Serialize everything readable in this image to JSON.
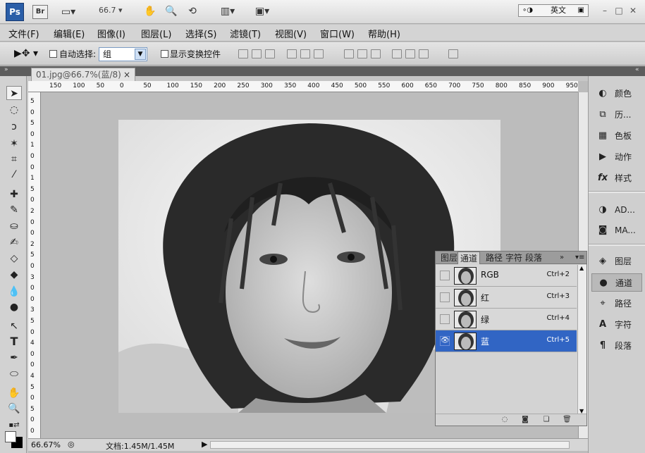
{
  "app": {
    "logo": "Ps",
    "bridge": "Br",
    "zoom": "66.7",
    "lang": "英文"
  },
  "menu": [
    "文件(F)",
    "编辑(E)",
    "图像(I)",
    "图层(L)",
    "选择(S)",
    "滤镜(T)",
    "视图(V)",
    "窗口(W)",
    "帮助(H)"
  ],
  "options": {
    "auto_select": "自动选择:",
    "auto_select_value": "组",
    "show_transform": "显示变换控件"
  },
  "document": {
    "tab_title": "01.jpg@66.7%(蓝/8)",
    "close": "×",
    "zoom_pct": "66.67%",
    "doc_size": "文档:1.45M/1.45M"
  },
  "ruler": {
    "h": [
      "150",
      "100",
      "50",
      "0",
      "50",
      "100",
      "150",
      "200",
      "250",
      "300",
      "350",
      "400",
      "450",
      "500",
      "550",
      "600",
      "650",
      "700",
      "750",
      "800",
      "850",
      "900",
      "950"
    ],
    "v": [
      "5",
      "0",
      "5",
      "0",
      "1",
      "0",
      "0",
      "1",
      "5",
      "0",
      "2",
      "0",
      "0",
      "2",
      "5",
      "0",
      "3",
      "0",
      "0",
      "3",
      "5",
      "0",
      "4",
      "0",
      "0",
      "4",
      "5",
      "0",
      "5",
      "0",
      "0"
    ]
  },
  "dock": [
    {
      "label": "颜色",
      "icon": "color-icon",
      "glyph": "◐"
    },
    {
      "label": "历...",
      "icon": "history-icon",
      "glyph": "⧉"
    },
    {
      "label": "色板",
      "icon": "swatches-icon",
      "glyph": "▦"
    },
    {
      "label": "动作",
      "icon": "actions-icon",
      "glyph": "▶"
    },
    {
      "label": "样式",
      "icon": "styles-icon",
      "glyph": "fx"
    },
    {
      "label": "AD...",
      "icon": "adjustments-icon",
      "glyph": "◑"
    },
    {
      "label": "MA...",
      "icon": "masks-icon",
      "glyph": "◙"
    },
    {
      "label": "图层",
      "icon": "layers-icon",
      "glyph": "◈"
    },
    {
      "label": "通道",
      "icon": "channels-icon",
      "glyph": "●"
    },
    {
      "label": "路径",
      "icon": "paths-icon",
      "glyph": "⌖"
    },
    {
      "label": "字符",
      "icon": "character-icon",
      "glyph": "A"
    },
    {
      "label": "段落",
      "icon": "paragraph-icon",
      "glyph": "¶"
    }
  ],
  "channels_panel": {
    "tabs": [
      "图层",
      "通道",
      "路径",
      "字符",
      "段落"
    ],
    "active_tab": "通道",
    "rows": [
      {
        "name": "RGB",
        "shortcut": "Ctrl+2",
        "visible": false,
        "selected": false
      },
      {
        "name": "红",
        "shortcut": "Ctrl+3",
        "visible": false,
        "selected": false
      },
      {
        "name": "绿",
        "shortcut": "Ctrl+4",
        "visible": false,
        "selected": false
      },
      {
        "name": "蓝",
        "shortcut": "Ctrl+5",
        "visible": true,
        "selected": true
      }
    ]
  }
}
